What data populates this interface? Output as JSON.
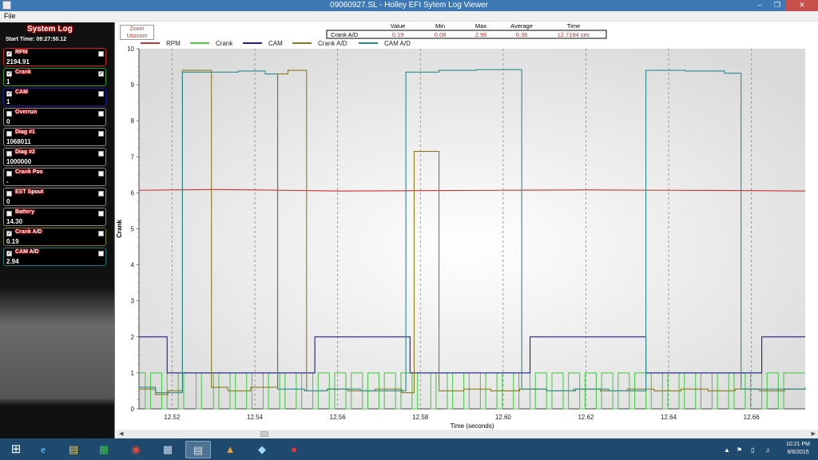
{
  "window": {
    "title": "09060927.SL - Holley EFI Sytem Log Viewer"
  },
  "menu": {
    "file": "File"
  },
  "sidebar": {
    "title": "System Log",
    "start_time": "Start Time: 09:27:50.12",
    "channels": [
      {
        "name": "RPM",
        "value": "2194.91",
        "checked": true,
        "right_check": false,
        "border": "#d02020"
      },
      {
        "name": "Crank",
        "value": "1",
        "checked": true,
        "right_check": true,
        "border": "#2aa02a"
      },
      {
        "name": "CAM",
        "value": "1",
        "checked": true,
        "right_check": false,
        "border": "#1a1a9a"
      },
      {
        "name": "Overrun",
        "value": "0",
        "checked": false,
        "right_check": false,
        "border": "#888888"
      },
      {
        "name": "Diag #1",
        "value": "1068011",
        "checked": false,
        "right_check": false,
        "border": "#888888"
      },
      {
        "name": "Diag #2",
        "value": "1000000",
        "checked": false,
        "right_check": false,
        "border": "#888888"
      },
      {
        "name": "Crank Pos",
        "value": "-",
        "checked": false,
        "right_check": false,
        "border": "#888888"
      },
      {
        "name": "EST Spout",
        "value": "0",
        "checked": false,
        "right_check": false,
        "border": "#888888"
      },
      {
        "name": "Battery",
        "value": "14.30",
        "checked": false,
        "right_check": false,
        "border": "#888888"
      },
      {
        "name": "Crank A/D",
        "value": "0.19",
        "checked": true,
        "right_check": false,
        "border": "#7a7a2a"
      },
      {
        "name": "CAM A/D",
        "value": "2.94",
        "checked": true,
        "right_check": false,
        "border": "#1a7a7a"
      }
    ]
  },
  "zoom": {
    "zoom_label": "Zoom",
    "unzoom_label": "Unzoom"
  },
  "stats": {
    "headers": [
      "Value",
      "Min",
      "Max",
      "Average",
      "Time"
    ],
    "row_label": "Crank A/D",
    "values": [
      "0.19",
      "0.08",
      "2.96",
      "0.36",
      "12.7194 sec"
    ]
  },
  "chart_data": {
    "type": "line",
    "xlabel": "Time (seconds)",
    "ylabel": "Crank",
    "xlim": [
      12.512,
      12.673
    ],
    "ylim": [
      0,
      10
    ],
    "x_ticks": [
      "12.52",
      "12.54",
      "12.56",
      "12.58",
      "12.60",
      "12.62",
      "12.64",
      "12.66"
    ],
    "y_ticks": [
      "0",
      "1",
      "2",
      "3",
      "4",
      "5",
      "6",
      "7",
      "8",
      "9",
      "10"
    ],
    "grid": "vertical-dashed",
    "legend_position": "top",
    "series": [
      {
        "name": "RPM",
        "color": "#c83232",
        "step": false,
        "points": [
          [
            12.512,
            6.07
          ],
          [
            12.52,
            6.08
          ],
          [
            12.53,
            6.09
          ],
          [
            12.54,
            6.08
          ],
          [
            12.56,
            6.05
          ],
          [
            12.58,
            6.06
          ],
          [
            12.6,
            6.07
          ],
          [
            12.62,
            6.08
          ],
          [
            12.64,
            6.07
          ],
          [
            12.66,
            6.06
          ],
          [
            12.673,
            6.05
          ]
        ]
      },
      {
        "name": "Crank",
        "color": "#4ccc4c",
        "step": true,
        "points": [
          [
            12.512,
            1
          ],
          [
            12.5135,
            0
          ],
          [
            12.5148,
            1
          ],
          [
            12.5175,
            0
          ],
          [
            12.5188,
            1
          ],
          [
            12.5215,
            0
          ],
          [
            12.5228,
            1
          ],
          [
            12.5258,
            0
          ],
          [
            12.5271,
            1
          ],
          [
            12.53,
            0
          ],
          [
            12.5313,
            1
          ],
          [
            12.534,
            0
          ],
          [
            12.5353,
            1
          ],
          [
            12.538,
            0
          ],
          [
            12.5393,
            1
          ],
          [
            12.542,
            0
          ],
          [
            12.5433,
            1
          ],
          [
            12.546,
            0
          ],
          [
            12.5473,
            1
          ],
          [
            12.55,
            0
          ],
          [
            12.5513,
            1
          ],
          [
            12.554,
            0
          ],
          [
            12.5553,
            1
          ],
          [
            12.558,
            0
          ],
          [
            12.5593,
            1
          ],
          [
            12.562,
            0
          ],
          [
            12.5633,
            1
          ],
          [
            12.566,
            0
          ],
          [
            12.5673,
            1
          ],
          [
            12.57,
            0
          ],
          [
            12.5713,
            1
          ],
          [
            12.574,
            0
          ],
          [
            12.5753,
            1
          ],
          [
            12.578,
            0
          ],
          [
            12.5793,
            1
          ],
          [
            12.5825,
            0
          ],
          [
            12.5838,
            1
          ],
          [
            12.5865,
            0
          ],
          [
            12.5878,
            1
          ],
          [
            12.5905,
            0
          ],
          [
            12.5918,
            1
          ],
          [
            12.5945,
            0
          ],
          [
            12.5958,
            1
          ],
          [
            12.5985,
            0
          ],
          [
            12.5998,
            1
          ],
          [
            12.6025,
            0
          ],
          [
            12.6038,
            1
          ],
          [
            12.6065,
            0
          ],
          [
            12.6078,
            1
          ],
          [
            12.6105,
            0
          ],
          [
            12.6118,
            1
          ],
          [
            12.6145,
            0
          ],
          [
            12.6158,
            1
          ],
          [
            12.6185,
            0
          ],
          [
            12.6198,
            1
          ],
          [
            12.6225,
            0
          ],
          [
            12.6238,
            1
          ],
          [
            12.6265,
            0
          ],
          [
            12.6278,
            1
          ],
          [
            12.6305,
            0
          ],
          [
            12.6318,
            1
          ],
          [
            12.6345,
            0
          ],
          [
            12.6358,
            1
          ],
          [
            12.6385,
            0
          ],
          [
            12.6398,
            1
          ],
          [
            12.6425,
            0
          ],
          [
            12.6438,
            1
          ],
          [
            12.6465,
            0
          ],
          [
            12.6478,
            1
          ],
          [
            12.6505,
            0
          ],
          [
            12.6518,
            1
          ],
          [
            12.6545,
            0
          ],
          [
            12.6558,
            1
          ],
          [
            12.6585,
            0
          ],
          [
            12.6598,
            1
          ],
          [
            12.6625,
            0
          ],
          [
            12.6638,
            1
          ],
          [
            12.6665,
            0
          ],
          [
            12.6678,
            1
          ],
          [
            12.673,
            1
          ]
        ]
      },
      {
        "name": "CAM",
        "color": "#1e1e8c",
        "step": true,
        "points": [
          [
            12.512,
            2
          ],
          [
            12.5188,
            1
          ],
          [
            12.5545,
            2
          ],
          [
            12.5775,
            1
          ],
          [
            12.6065,
            2
          ],
          [
            12.6345,
            1
          ],
          [
            12.6625,
            2
          ],
          [
            12.673,
            2
          ]
        ]
      },
      {
        "name": "Crank A/D",
        "color": "#8a7a1e",
        "step": true,
        "points": [
          [
            12.512,
            0.55
          ],
          [
            12.516,
            0.4
          ],
          [
            12.519,
            0.5
          ],
          [
            12.5225,
            9.4
          ],
          [
            12.5295,
            0.6
          ],
          [
            12.5335,
            0.5
          ],
          [
            12.539,
            0.6
          ],
          [
            12.5455,
            9.3
          ],
          [
            12.548,
            9.4
          ],
          [
            12.5525,
            0.5
          ],
          [
            12.5575,
            0.55
          ],
          [
            12.5625,
            0.5
          ],
          [
            12.569,
            0.55
          ],
          [
            12.5755,
            0.45
          ],
          [
            12.5785,
            7.15
          ],
          [
            12.5845,
            0.5
          ],
          [
            12.5905,
            0.55
          ],
          [
            12.597,
            0.5
          ],
          [
            12.604,
            0.55
          ],
          [
            12.6105,
            0.5
          ],
          [
            12.617,
            0.55
          ],
          [
            12.6235,
            0.5
          ],
          [
            12.63,
            0.55
          ],
          [
            12.6365,
            0.5
          ],
          [
            12.643,
            0.55
          ],
          [
            12.6495,
            0.5
          ],
          [
            12.656,
            0.55
          ],
          [
            12.662,
            0.5
          ],
          [
            12.668,
            0.55
          ],
          [
            12.673,
            0.55
          ]
        ]
      },
      {
        "name": "CAM A/D",
        "color": "#2a8a8a",
        "step": true,
        "points": [
          [
            12.512,
            0.6
          ],
          [
            12.516,
            0.45
          ],
          [
            12.5225,
            9.35
          ],
          [
            12.536,
            9.38
          ],
          [
            12.5425,
            9.3
          ],
          [
            12.5455,
            0.55
          ],
          [
            12.552,
            0.5
          ],
          [
            12.5575,
            0.55
          ],
          [
            12.5655,
            0.5
          ],
          [
            12.5765,
            9.35
          ],
          [
            12.5845,
            9.4
          ],
          [
            12.5935,
            9.42
          ],
          [
            12.6045,
            0.55
          ],
          [
            12.6105,
            0.5
          ],
          [
            12.6175,
            0.55
          ],
          [
            12.6255,
            0.5
          ],
          [
            12.6345,
            9.4
          ],
          [
            12.644,
            9.38
          ],
          [
            12.6535,
            9.32
          ],
          [
            12.6575,
            0.55
          ],
          [
            12.665,
            0.55
          ],
          [
            12.673,
            0.6
          ]
        ]
      }
    ]
  },
  "taskbar": {
    "time": "10:21 PM",
    "date": "9/6/2015"
  }
}
